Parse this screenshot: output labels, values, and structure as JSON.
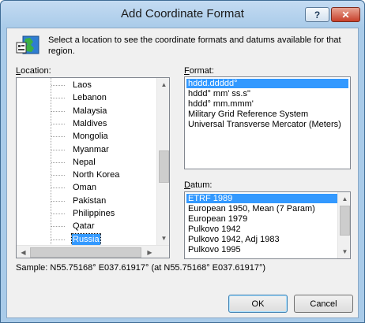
{
  "window": {
    "title": "Add Coordinate Format",
    "help_glyph": "?",
    "close_glyph": "✕"
  },
  "intro_text": "Select a location to see the coordinate formats and datums available for that region.",
  "location": {
    "label_prefix": "",
    "label_hot": "L",
    "label_rest": "ocation:",
    "items": [
      "Laos",
      "Lebanon",
      "Malaysia",
      "Maldives",
      "Mongolia",
      "Myanmar",
      "Nepal",
      "North Korea",
      "Oman",
      "Pakistan",
      "Philippines",
      "Qatar",
      "Russia"
    ],
    "selected": "Russia"
  },
  "format": {
    "label_hot": "F",
    "label_rest": "ormat:",
    "options": [
      "hddd.ddddd°",
      "hddd° mm' ss.s\"",
      "hddd° mm.mmm'",
      "Military Grid Reference System",
      "Universal Transverse Mercator (Meters)"
    ],
    "selected": "hddd.ddddd°"
  },
  "datum": {
    "label_hot": "D",
    "label_rest": "atum:",
    "options": [
      "ETRF 1989",
      "European 1950, Mean (7 Param)",
      "European 1979",
      "Pulkovo 1942",
      "Pulkovo 1942, Adj 1983",
      "Pulkovo 1995"
    ],
    "selected": "ETRF 1989"
  },
  "sample_text": "Sample: N55.75168°  E037.61917° (at N55.75168°  E037.61917°)",
  "buttons": {
    "ok": "OK",
    "cancel": "Cancel"
  },
  "icons": {
    "globe": "globe-icon",
    "scroll_up": "▲",
    "scroll_down": "▼",
    "scroll_left": "◀",
    "scroll_right": "▶"
  },
  "colors": {
    "selection": "#3399ff",
    "frame": "#a9cbe9",
    "close": "#c8402b"
  }
}
